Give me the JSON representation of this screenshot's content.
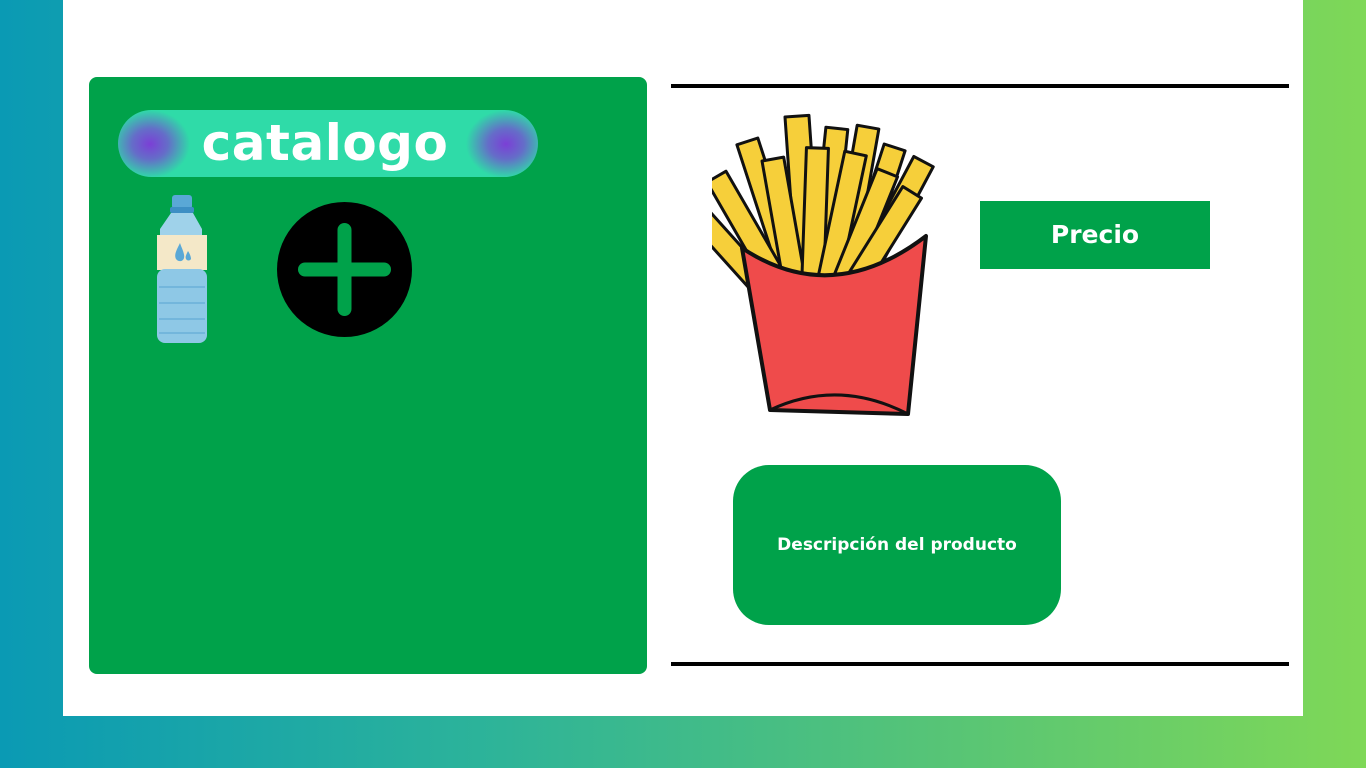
{
  "catalog": {
    "title": "catalogo",
    "items": [
      {
        "icon": "water-bottle-icon"
      }
    ],
    "add_button_icon": "plus-icon"
  },
  "product": {
    "image_icon": "french-fries-icon",
    "price_label": "Precio",
    "description_label": "Descripción del producto"
  },
  "colors": {
    "panel_green": "#00a24a",
    "banner_teal": "#2fdba8",
    "banner_purple": "#7b3fd6",
    "sheet": "#ffffff",
    "gradient_left": "#0a9ab4",
    "gradient_right": "#7fd857"
  }
}
